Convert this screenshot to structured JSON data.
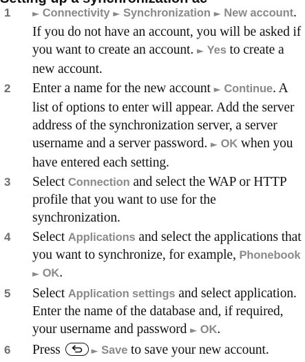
{
  "top_text": "Setting up a synchronization account",
  "steps": [
    {
      "number": "1",
      "p1": "Connectivity",
      "p2": "Synchronization",
      "p3": "New account",
      "p4": ". If you do not have an account, you will be asked if you want to create an account.",
      "p5": "Yes",
      "p6": " to create a new account."
    },
    {
      "number": "2",
      "p1": "Enter a name for the new account ",
      "p2": "Continue",
      "p3": ". A list of options to enter will appear. Add the server address of the synchronization server, a server username and a server password. ",
      "p4": "OK",
      "p5": " when you have entered each setting."
    },
    {
      "number": "3",
      "p1": "Select ",
      "p2": "Connection",
      "p3": " and select the WAP or HTTP profile that you want to use for the synchronization."
    },
    {
      "number": "4",
      "p1": "Select ",
      "p2": "Applications",
      "p3": " and select the applications that you want to synchronize, for example, ",
      "p4": "Phonebook",
      "p5": "OK",
      "p6": "."
    },
    {
      "number": "5",
      "p1": "Select ",
      "p2": "Application settings",
      "p3": " and select application. Enter the name of the database and, if required, your username and password ",
      "p4": "OK",
      "p5": "."
    },
    {
      "number": "6",
      "p1": "Press ",
      "p2": "Save",
      "p3": " to save your new account."
    }
  ],
  "arrow_glyph": "►",
  "colors": {
    "text": "#111111",
    "menu_item": "#8a8a8a",
    "step_number": "#6e6e6e"
  }
}
